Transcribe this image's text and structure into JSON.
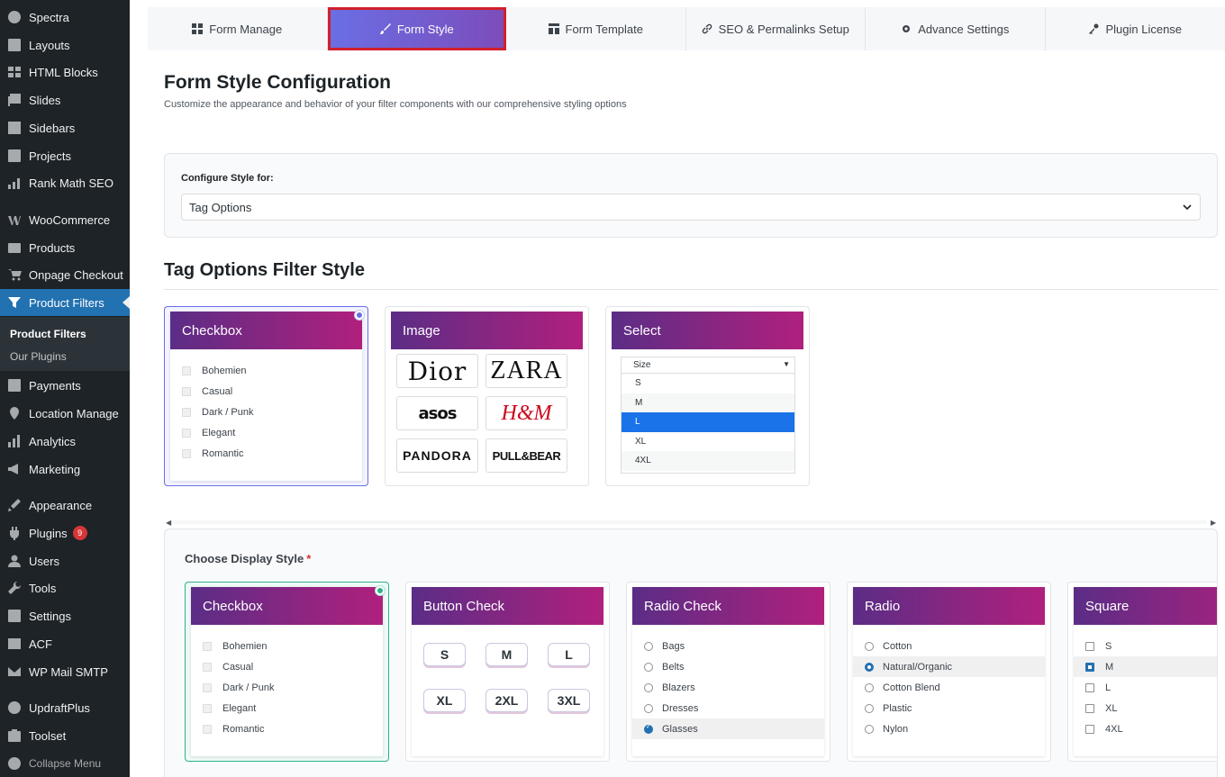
{
  "sidebar": {
    "items": [
      {
        "label": "Spectra",
        "icon": "spectra-icon"
      },
      {
        "label": "Layouts",
        "icon": "layouts-icon"
      },
      {
        "label": "HTML Blocks",
        "icon": "html-blocks-icon"
      },
      {
        "label": "Slides",
        "icon": "slides-icon"
      },
      {
        "label": "Sidebars",
        "icon": "sidebars-icon"
      },
      {
        "label": "Projects",
        "icon": "projects-icon"
      },
      {
        "label": "Rank Math SEO",
        "icon": "rank-math-icon"
      },
      {
        "label": "WooCommerce",
        "icon": "woocommerce-icon"
      },
      {
        "label": "Products",
        "icon": "products-icon"
      },
      {
        "label": "Onpage Checkout",
        "icon": "cart-icon"
      },
      {
        "label": "Product Filters",
        "icon": "filter-icon"
      },
      {
        "label": "Payments",
        "icon": "payments-icon"
      },
      {
        "label": "Location Manage",
        "icon": "location-icon"
      },
      {
        "label": "Analytics",
        "icon": "analytics-icon"
      },
      {
        "label": "Marketing",
        "icon": "marketing-icon"
      },
      {
        "label": "Appearance",
        "icon": "appearance-icon"
      },
      {
        "label": "Plugins",
        "icon": "plugins-icon",
        "badge": "9"
      },
      {
        "label": "Users",
        "icon": "users-icon"
      },
      {
        "label": "Tools",
        "icon": "tools-icon"
      },
      {
        "label": "Settings",
        "icon": "settings-icon"
      },
      {
        "label": "ACF",
        "icon": "acf-icon"
      },
      {
        "label": "WP Mail SMTP",
        "icon": "mail-icon"
      },
      {
        "label": "UpdraftPlus",
        "icon": "updraft-icon"
      },
      {
        "label": "Toolset",
        "icon": "toolset-icon"
      }
    ],
    "submenu": [
      {
        "label": "Product Filters"
      },
      {
        "label": "Our Plugins"
      }
    ],
    "collapse_label": "Collapse Menu"
  },
  "tabs": [
    {
      "label": "Form Manage",
      "icon": "grid-icon"
    },
    {
      "label": "Form Style",
      "icon": "brush-icon"
    },
    {
      "label": "Form Template",
      "icon": "template-icon"
    },
    {
      "label": "SEO & Permalinks Setup",
      "icon": "link-icon"
    },
    {
      "label": "Advance Settings",
      "icon": "gear-icon"
    },
    {
      "label": "Plugin License",
      "icon": "key-icon"
    }
  ],
  "page": {
    "title": "Form Style Configuration",
    "subtitle": "Customize the appearance and behavior of your filter components with our comprehensive styling options"
  },
  "config": {
    "label": "Configure Style for:",
    "selected": "Tag Options"
  },
  "filter_style": {
    "title": "Tag Options Filter Style",
    "cards": {
      "checkbox": {
        "title": "Checkbox",
        "options": [
          "Bohemien",
          "Casual",
          "Dark / Punk",
          "Elegant",
          "Romantic"
        ]
      },
      "image": {
        "title": "Image",
        "brands": [
          "Dior",
          "ZARA",
          "asos",
          "H&M",
          "PANDORA",
          "PULL&BEAR"
        ]
      },
      "select": {
        "title": "Select",
        "placeholder": "Size",
        "arrow": "▼",
        "options": [
          "S",
          "M",
          "L",
          "XL",
          "4XL"
        ],
        "selected": "L"
      }
    }
  },
  "display_style": {
    "label": "Choose Display Style",
    "required_mark": "*",
    "cards": {
      "checkbox": {
        "title": "Checkbox",
        "options": [
          "Bohemien",
          "Casual",
          "Dark / Punk",
          "Elegant",
          "Romantic"
        ]
      },
      "button_check": {
        "title": "Button Check",
        "options": [
          "S",
          "M",
          "L",
          "XL",
          "2XL",
          "3XL"
        ]
      },
      "radio_check": {
        "title": "Radio Check",
        "options": [
          "Bags",
          "Belts",
          "Blazers",
          "Dresses",
          "Glasses"
        ],
        "checked": "Glasses"
      },
      "radio": {
        "title": "Radio",
        "options": [
          "Cotton",
          "Natural/Organic",
          "Cotton Blend",
          "Plastic",
          "Nylon"
        ],
        "checked": "Natural/Organic"
      },
      "square": {
        "title": "Square",
        "options": [
          "S",
          "M",
          "L",
          "XL",
          "4XL"
        ],
        "checked": "M"
      }
    }
  },
  "colors": {
    "admin_bar": "#1d2327",
    "accent": "#2271b1",
    "tab_gradient_start": "#6a6ee4",
    "tab_gradient_end": "#7c4dbb",
    "card_header_start": "#5b2d86",
    "card_header_end": "#b0207d",
    "highlight_border": "#d1202b",
    "selected_green": "#2eb287"
  }
}
